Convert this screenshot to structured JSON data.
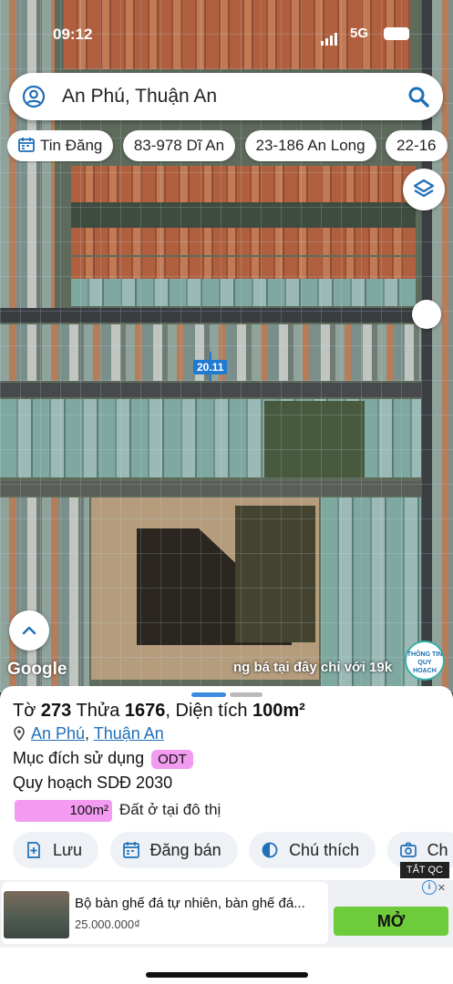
{
  "status_bar": {
    "time": "09:12",
    "network": "5G"
  },
  "search": {
    "value": "An Phú, Thuận An"
  },
  "chips": [
    {
      "label": "Tin Đăng"
    },
    {
      "label": "83-978 Dĩ An"
    },
    {
      "label": "23-186 An Long"
    },
    {
      "label": "22-16"
    }
  ],
  "map": {
    "plot_label": "20.11",
    "attribution": "Google",
    "promo": "ng bá tại đây chỉ với 19k",
    "info_logo": "THÔNG TIN QUY HOẠCH"
  },
  "parcel": {
    "title_prefix": "Tờ",
    "sheet_no": "273",
    "parcel_word": "Thửa",
    "parcel_no": "1676",
    "area_word": ", Diện tích",
    "area": "100m²",
    "ward": "An Phú",
    "district": "Thuận An",
    "sep": ",",
    "purpose_label": "Mục đích sử dụng",
    "purpose_code": "ODT",
    "plan_label": "Quy hoạch SDĐ 2030",
    "plan_area": "100m²",
    "plan_desc": "Đất ở tại đô thị",
    "plan_fraction": 1.0
  },
  "actions": [
    {
      "label": "Lưu"
    },
    {
      "label": "Đăng bán"
    },
    {
      "label": "Chú thích"
    },
    {
      "label": "Ch"
    }
  ],
  "ad": {
    "tag": "TẮT QC",
    "title": "Bộ bàn ghế đá tự nhiên, bàn ghế đá...",
    "price": "25.000.000₫",
    "cta": "MỞ"
  },
  "colors": {
    "accent": "#1f6fb8",
    "odt": "#f29bf0",
    "cta": "#6ecb3c"
  }
}
